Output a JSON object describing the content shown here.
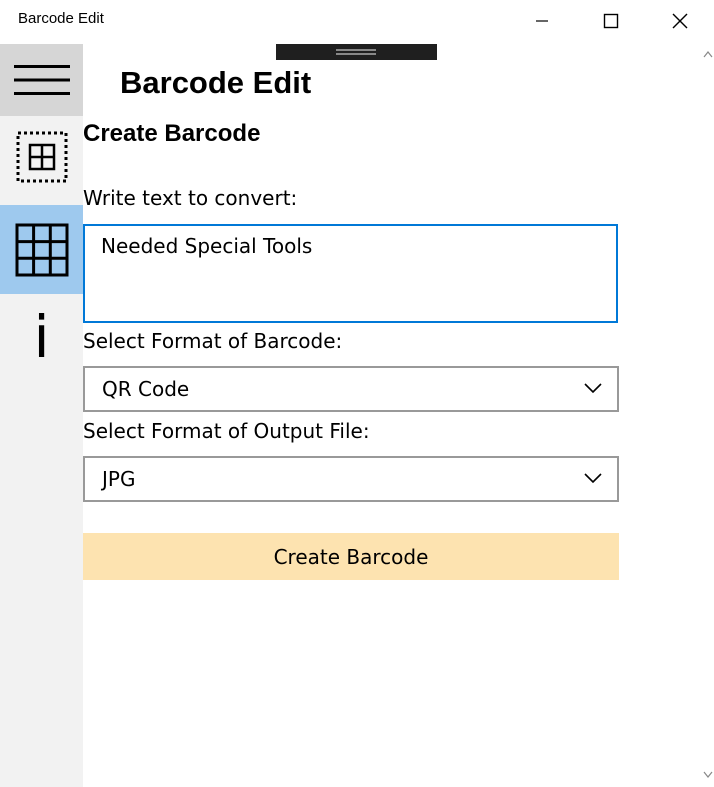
{
  "window": {
    "title": "Barcode Edit"
  },
  "sidebar": {
    "items": [
      {
        "name": "menu",
        "icon": "hamburger-icon"
      },
      {
        "name": "create",
        "icon": "barcode-create-icon"
      },
      {
        "name": "scan",
        "icon": "grid-icon"
      },
      {
        "name": "info",
        "icon": "info-icon",
        "glyph": "i"
      }
    ],
    "accent": "#9ec9ee"
  },
  "header": {
    "app_title": "Barcode Edit",
    "section_title": "Create Barcode"
  },
  "form": {
    "text_label": "Write text to convert:",
    "text_value": "Needed Special Tools",
    "barcode_format_label": "Select Format of Barcode:",
    "barcode_format_value": "QR Code",
    "output_format_label": "Select Format of Output File:",
    "output_format_value": "JPG",
    "create_button": "Create Barcode",
    "button_color": "#fde3b0",
    "focus_color": "#0078d7"
  }
}
